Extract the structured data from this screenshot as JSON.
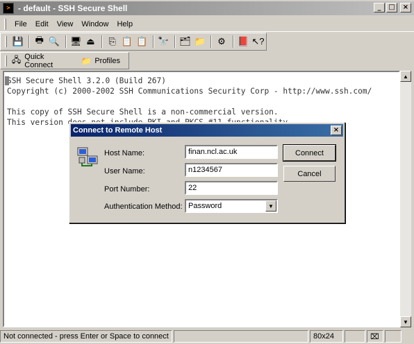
{
  "window": {
    "title": "- default - SSH Secure Shell"
  },
  "menu": {
    "items": [
      "File",
      "Edit",
      "View",
      "Window",
      "Help"
    ]
  },
  "profilebar": {
    "quick_connect": "Quick Connect",
    "profiles": "Profiles"
  },
  "terminal": {
    "lines": [
      "SSH Secure Shell 3.2.0 (Build 267)",
      "Copyright (c) 2000-2002 SSH Communications Security Corp - http://www.ssh.com/",
      "",
      "This copy of SSH Secure Shell is a non-commercial version.",
      "This version does not include PKI and PKCS #11 functionality."
    ]
  },
  "dialog": {
    "title": "Connect to Remote Host",
    "labels": {
      "host": "Host Name:",
      "user": "User Name:",
      "port": "Port Number:",
      "auth": "Authentication Method:"
    },
    "values": {
      "host": "finan.ncl.ac.uk",
      "user": "n1234567",
      "port": "22",
      "auth": "Password"
    },
    "connect": "Connect",
    "cancel": "Cancel"
  },
  "status": {
    "message": "Not connected - press Enter or Space to connect",
    "size": "80x24"
  }
}
